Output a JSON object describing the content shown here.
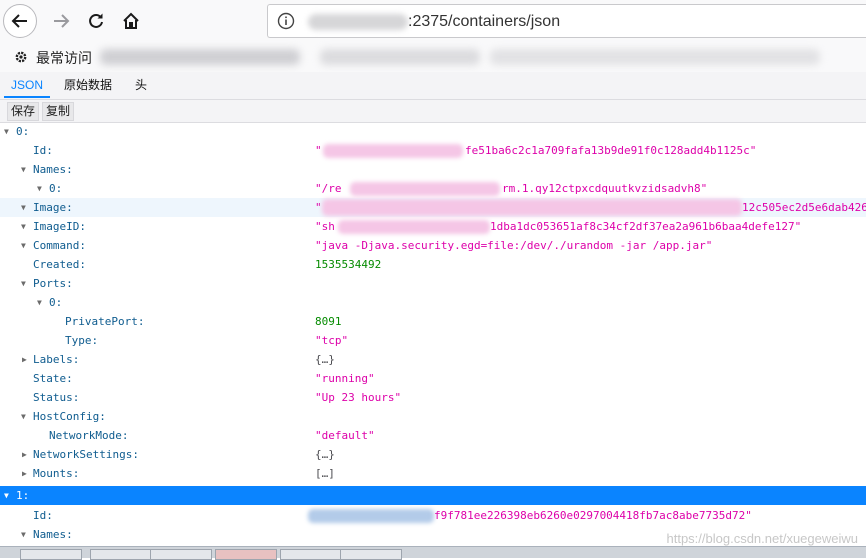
{
  "browser": {
    "url_visible": ":2375/containers/json",
    "bookmarks_label": "最常访问"
  },
  "viewer": {
    "tabs": [
      {
        "label": "JSON",
        "active": true
      },
      {
        "label": "原始数据",
        "active": false
      },
      {
        "label": "头",
        "active": false
      }
    ],
    "toolbar": {
      "save": "保存",
      "copy": "复制"
    }
  },
  "tree": {
    "root0": {
      "key": "0:"
    },
    "id": {
      "key": "Id:",
      "q_open": "\"",
      "value": "fe51ba6c2c1a709fafa13b9de91f0c128add4b1125c\""
    },
    "names": {
      "key": "Names:"
    },
    "names0": {
      "key": "0:",
      "value_start": "\"/re",
      "value": "rm.1.qy12ctpxcdquutkvzidsadvh8\""
    },
    "image": {
      "key": "Image:",
      "value_start": "\"",
      "value": "12c505ec2d5e6dab426"
    },
    "imageid": {
      "key": "ImageID:",
      "value_start": "\"sh",
      "value": "1dba1dc053651af8c34cf2df37ea2a961b6baa4defe127\""
    },
    "command": {
      "key": "Command:",
      "value": "\"java -Djava.security.egd=file:/dev/./urandom -jar /app.jar\""
    },
    "created": {
      "key": "Created:",
      "value": "1535534492"
    },
    "ports": {
      "key": "Ports:"
    },
    "ports0": {
      "key": "0:"
    },
    "privateport": {
      "key": "PrivatePort:",
      "value": "8091"
    },
    "type": {
      "key": "Type:",
      "value": "\"tcp\""
    },
    "labels": {
      "key": "Labels:",
      "value": "{…}"
    },
    "state": {
      "key": "State:",
      "value": "\"running\""
    },
    "status": {
      "key": "Status:",
      "value": "\"Up 23 hours\""
    },
    "hostconfig": {
      "key": "HostConfig:"
    },
    "networkmode": {
      "key": "NetworkMode:",
      "value": "\"default\""
    },
    "networksettings": {
      "key": "NetworkSettings:",
      "value": "{…}"
    },
    "mounts": {
      "key": "Mounts:",
      "value": "[…]"
    },
    "root1": {
      "key": "1:"
    },
    "id1": {
      "key": "Id:",
      "value": "f9f781ee226398eb6260e0297004418fb7ac8abe7735d72\""
    },
    "names1": {
      "key": "Names:"
    }
  },
  "watermark": "https://blog.csdn.net/xuegeweiwu"
}
